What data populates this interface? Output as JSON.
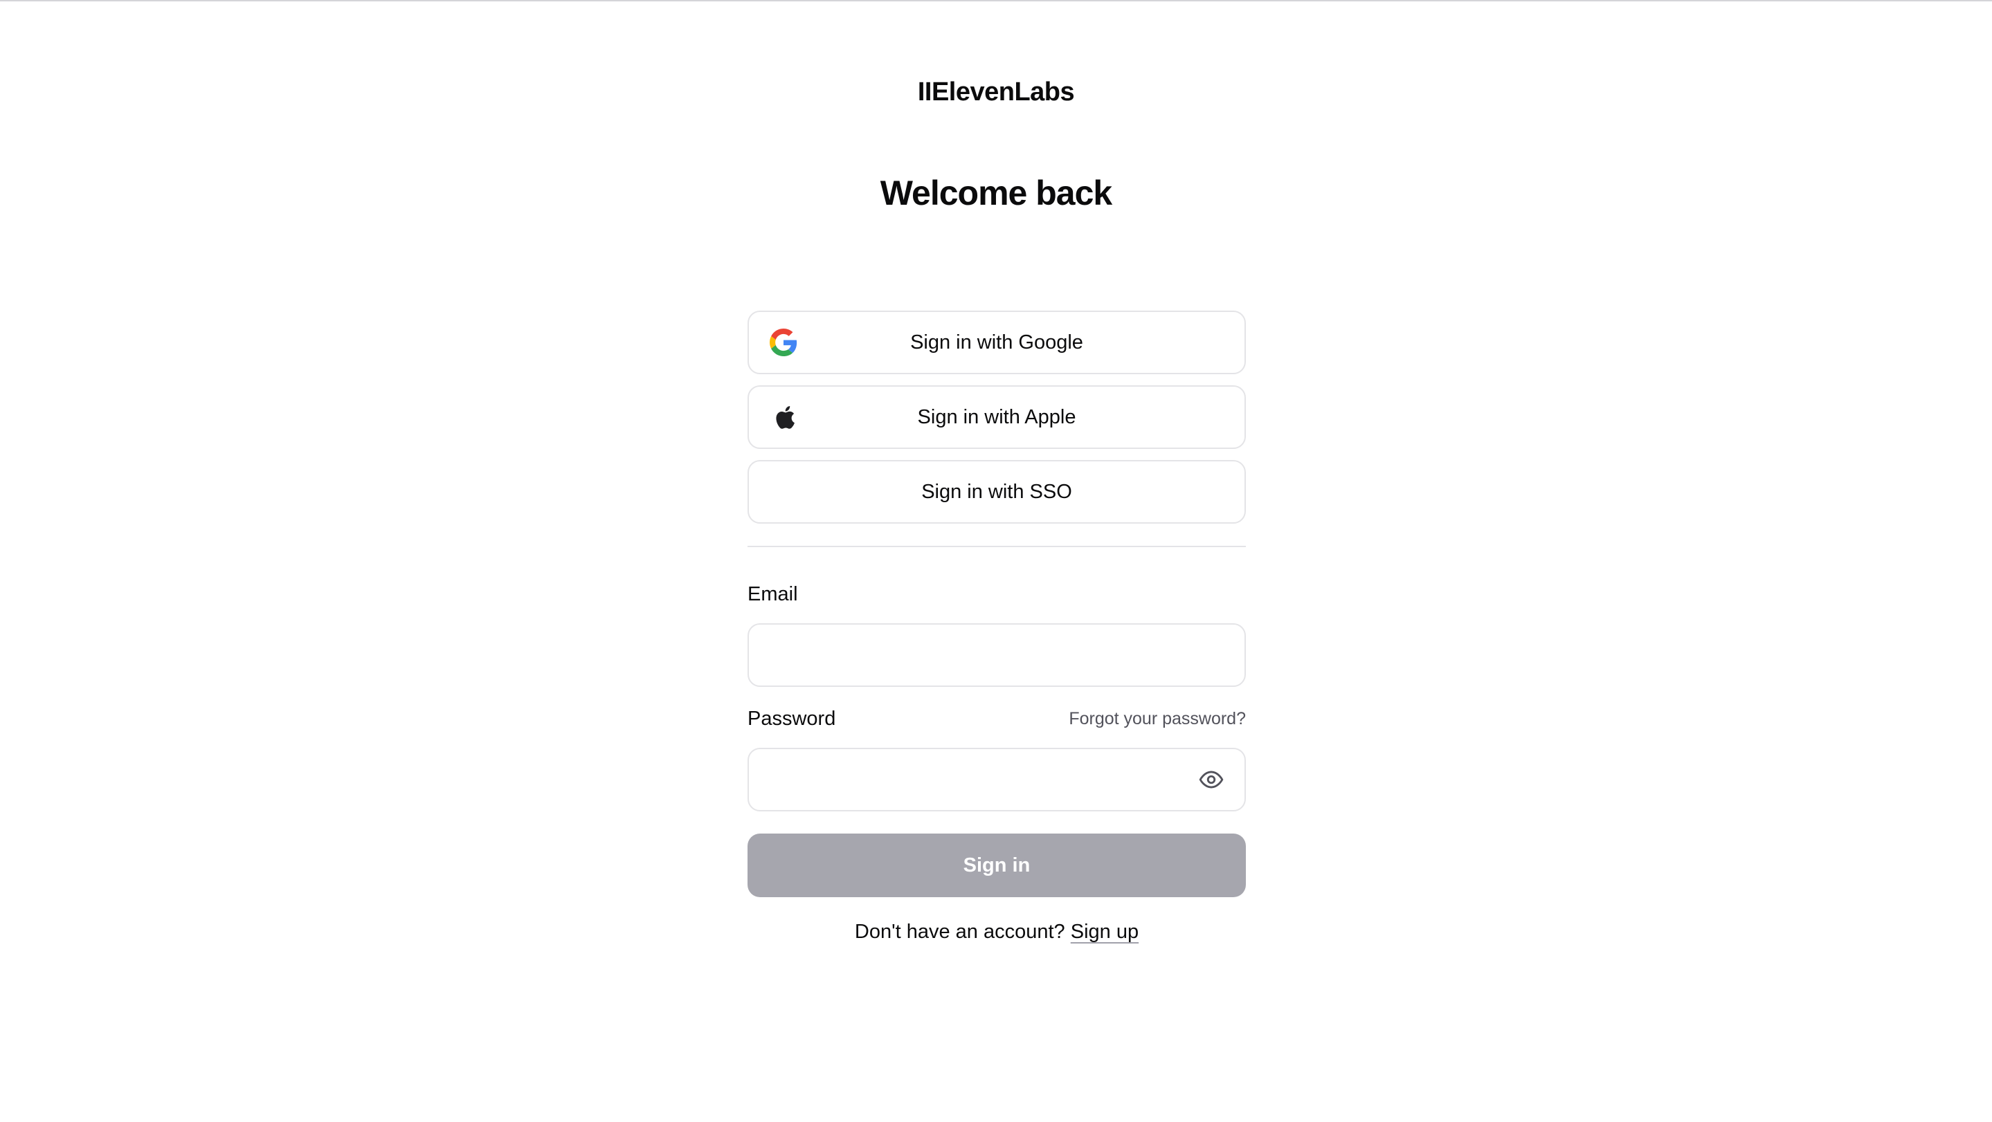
{
  "brand": {
    "logo_text": "IIElevenLabs"
  },
  "page": {
    "title": "Welcome back"
  },
  "social_buttons": {
    "google_label": "Sign in with Google",
    "apple_label": "Sign in with Apple",
    "sso_label": "Sign in with SSO",
    "google_icon": "google-icon",
    "apple_icon": "apple-icon"
  },
  "email": {
    "label": "Email",
    "value": "",
    "placeholder": ""
  },
  "password": {
    "label": "Password",
    "forgot_label": "Forgot your password?",
    "value": "",
    "placeholder": "",
    "toggle_icon": "eye-icon"
  },
  "submit": {
    "label": "Sign in",
    "disabled_color": "#a6a6ae"
  },
  "footer": {
    "prompt": "Don't have an account?",
    "signup_label": "Sign up"
  }
}
